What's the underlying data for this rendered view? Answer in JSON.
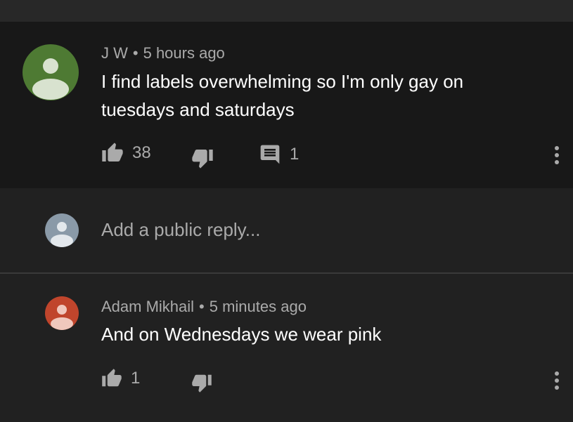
{
  "comment": {
    "author": "J W",
    "separator": "•",
    "time": "5 hours ago",
    "text": "I find labels overwhelming so I'm only gay on tuesdays and saturdays",
    "like_count": "38",
    "reply_count": "1",
    "avatar_color": "#4e7a33"
  },
  "reply_box": {
    "placeholder": "Add a public reply...",
    "avatar_color": "#8a9aa8"
  },
  "reply": {
    "author": "Adam Mikhail",
    "separator": "•",
    "time": "5 minutes ago",
    "text": "And on Wednesdays we wear pink",
    "like_count": "1",
    "avatar_color": "#c0452c"
  },
  "icons": [
    "thumbs-up-icon",
    "thumbs-down-icon",
    "reply-icon",
    "more-vert-icon"
  ]
}
